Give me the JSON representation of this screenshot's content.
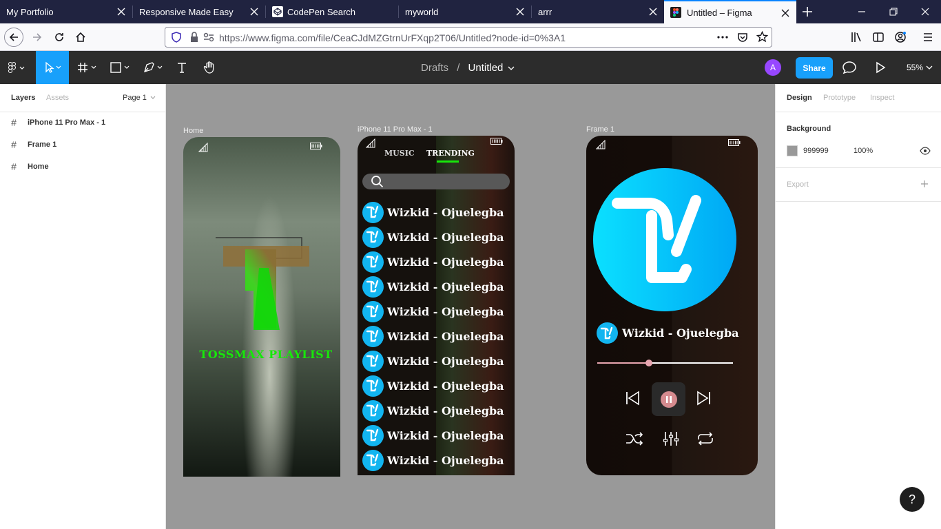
{
  "browser": {
    "tabs": [
      {
        "label": "My Portfolio"
      },
      {
        "label": "Responsive Made Easy"
      },
      {
        "label": "CodePen Search"
      },
      {
        "label": "myworld"
      },
      {
        "label": "arrr"
      },
      {
        "label": "Untitled – Figma",
        "active": true
      }
    ],
    "url": "https://www.figma.com/file/CeaCJdMZGtrnUrFXqp2T06/Untitled?node-id=0%3A1"
  },
  "figma": {
    "breadcrumb": {
      "folder": "Drafts",
      "separator": "/",
      "file": "Untitled"
    },
    "avatar_initial": "A",
    "share_label": "Share",
    "zoom": "55%",
    "left_panel": {
      "tabs": [
        "Layers",
        "Assets"
      ],
      "page": "Page 1",
      "layers": [
        "iPhone 11 Pro Max - 1",
        "Frame 1",
        "Home"
      ]
    },
    "right_panel": {
      "tabs": [
        "Design",
        "Prototype",
        "Inspect"
      ],
      "background_label": "Background",
      "background_hex": "999999",
      "background_opacity": "100%",
      "export_label": "Export"
    },
    "canvas": {
      "background": "#999999",
      "frames": {
        "home": {
          "label": "Home",
          "playlist_title": "TOSSMAX PLAYLIST"
        },
        "iphone": {
          "label": "iPhone 11 Pro Max - 1",
          "tabs": [
            "MUSIC",
            "TRENDING"
          ],
          "songs": [
            "Wizkid - Ojuelegba",
            "Wizkid - Ojuelegba",
            "Wizkid - Ojuelegba",
            "Wizkid - Ojuelegba",
            "Wizkid - Ojuelegba",
            "Wizkid - Ojuelegba",
            "Wizkid - Ojuelegba",
            "Wizkid - Ojuelegba",
            "Wizkid - Ojuelegba",
            "Wizkid - Ojuelegba",
            "Wizkid - Ojuelegba"
          ]
        },
        "frame1": {
          "label": "Frame 1",
          "now_playing": "Wizkid - Ojuelegba",
          "progress": 0.38
        }
      }
    },
    "help_label": "?"
  },
  "colors": {
    "figma_blue": "#18a0fb",
    "accent_green": "#17e80a",
    "brand_cyan": "#12b5f0",
    "avatar_purple": "#9747ff"
  }
}
